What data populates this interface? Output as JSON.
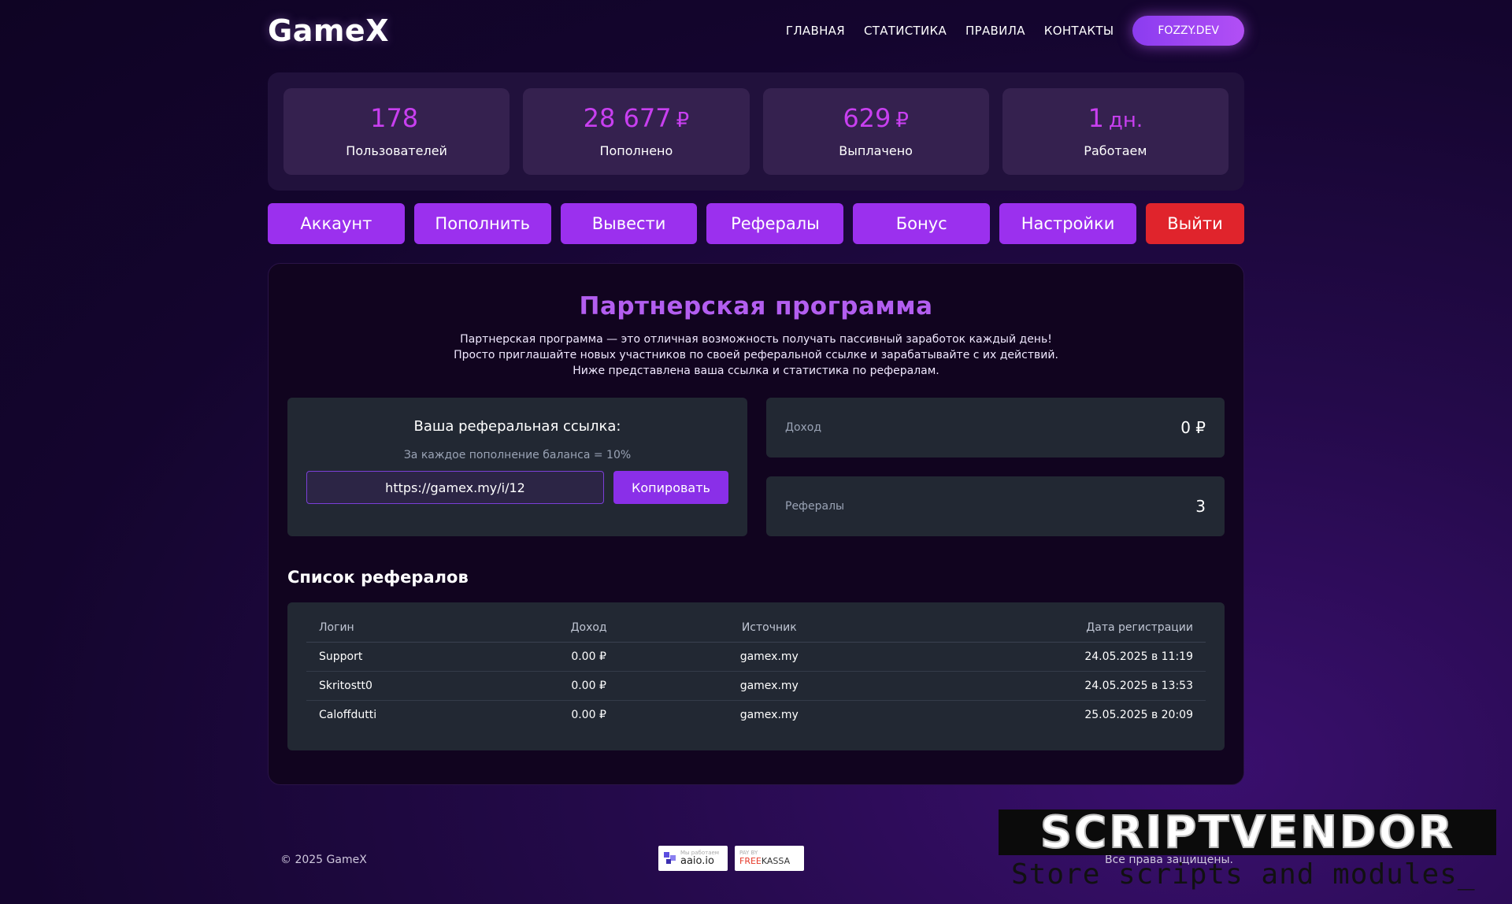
{
  "header": {
    "logo": "GameX",
    "nav": [
      "ГЛАВНАЯ",
      "СТАТИСТИКА",
      "ПРАВИЛА",
      "КОНТАКТЫ"
    ],
    "user_button": "FOZZY.DEV"
  },
  "stats": [
    {
      "value": "178",
      "unit": "",
      "label": "Пользователей"
    },
    {
      "value": "28 677",
      "unit": "₽",
      "label": "Пополнено"
    },
    {
      "value": "629",
      "unit": "₽",
      "label": "Выплачено"
    },
    {
      "value": "1",
      "unit": "дн.",
      "label": "Работаем"
    }
  ],
  "actions": [
    "Аккаунт",
    "Пополнить",
    "Вывести",
    "Рефералы",
    "Бонус",
    "Настройки",
    "Выйти"
  ],
  "panel": {
    "title": "Партнерская программа",
    "description": [
      "Партнерская программа — это отличная возможность получать пассивный заработок каждый день!",
      "Просто приглашайте новых участников по своей реферальной ссылке и зарабатывайте с их действий.",
      "Ниже представлена ваша ссылка и статистика по рефералам."
    ],
    "ref_title": "Ваша реферальная ссылка:",
    "ref_subtitle": "За каждое пополнение баланса = 10%",
    "ref_link": "https://gamex.my/i/12",
    "copy_label": "Копировать",
    "income_label": "Доход",
    "income_value": "0 ₽",
    "referrals_label": "Рефералы",
    "referrals_value": "3",
    "list_title": "Список рефералов",
    "table": {
      "headers": [
        "Логин",
        "Доход",
        "Источник",
        "Дата регистрации"
      ],
      "rows": [
        [
          "Support",
          "0.00 ₽",
          "gamex.my",
          "24.05.2025 в 11:19"
        ],
        [
          "Skritostt0",
          "0.00 ₽",
          "gamex.my",
          "24.05.2025 в 13:53"
        ],
        [
          "Caloffdutti",
          "0.00 ₽",
          "gamex.my",
          "25.05.2025 в 20:09"
        ]
      ]
    }
  },
  "footer": {
    "copyright": "© 2025 GameX",
    "aaio_small": "Мы работаем",
    "aaio_label": "aaio.io",
    "fk_small": "PAY BY",
    "fk_free": "FREE",
    "fk_kassa": "KASSA",
    "rights": "Все права защищены."
  },
  "watermark": {
    "logo": "SCRIPTVENDOR",
    "tagline": "Store scripts and modules_"
  },
  "colors": {
    "accent": "#9b30ee",
    "stat_value": "#c83ff0",
    "logout": "#e0242c",
    "title": "#b35ef0"
  }
}
